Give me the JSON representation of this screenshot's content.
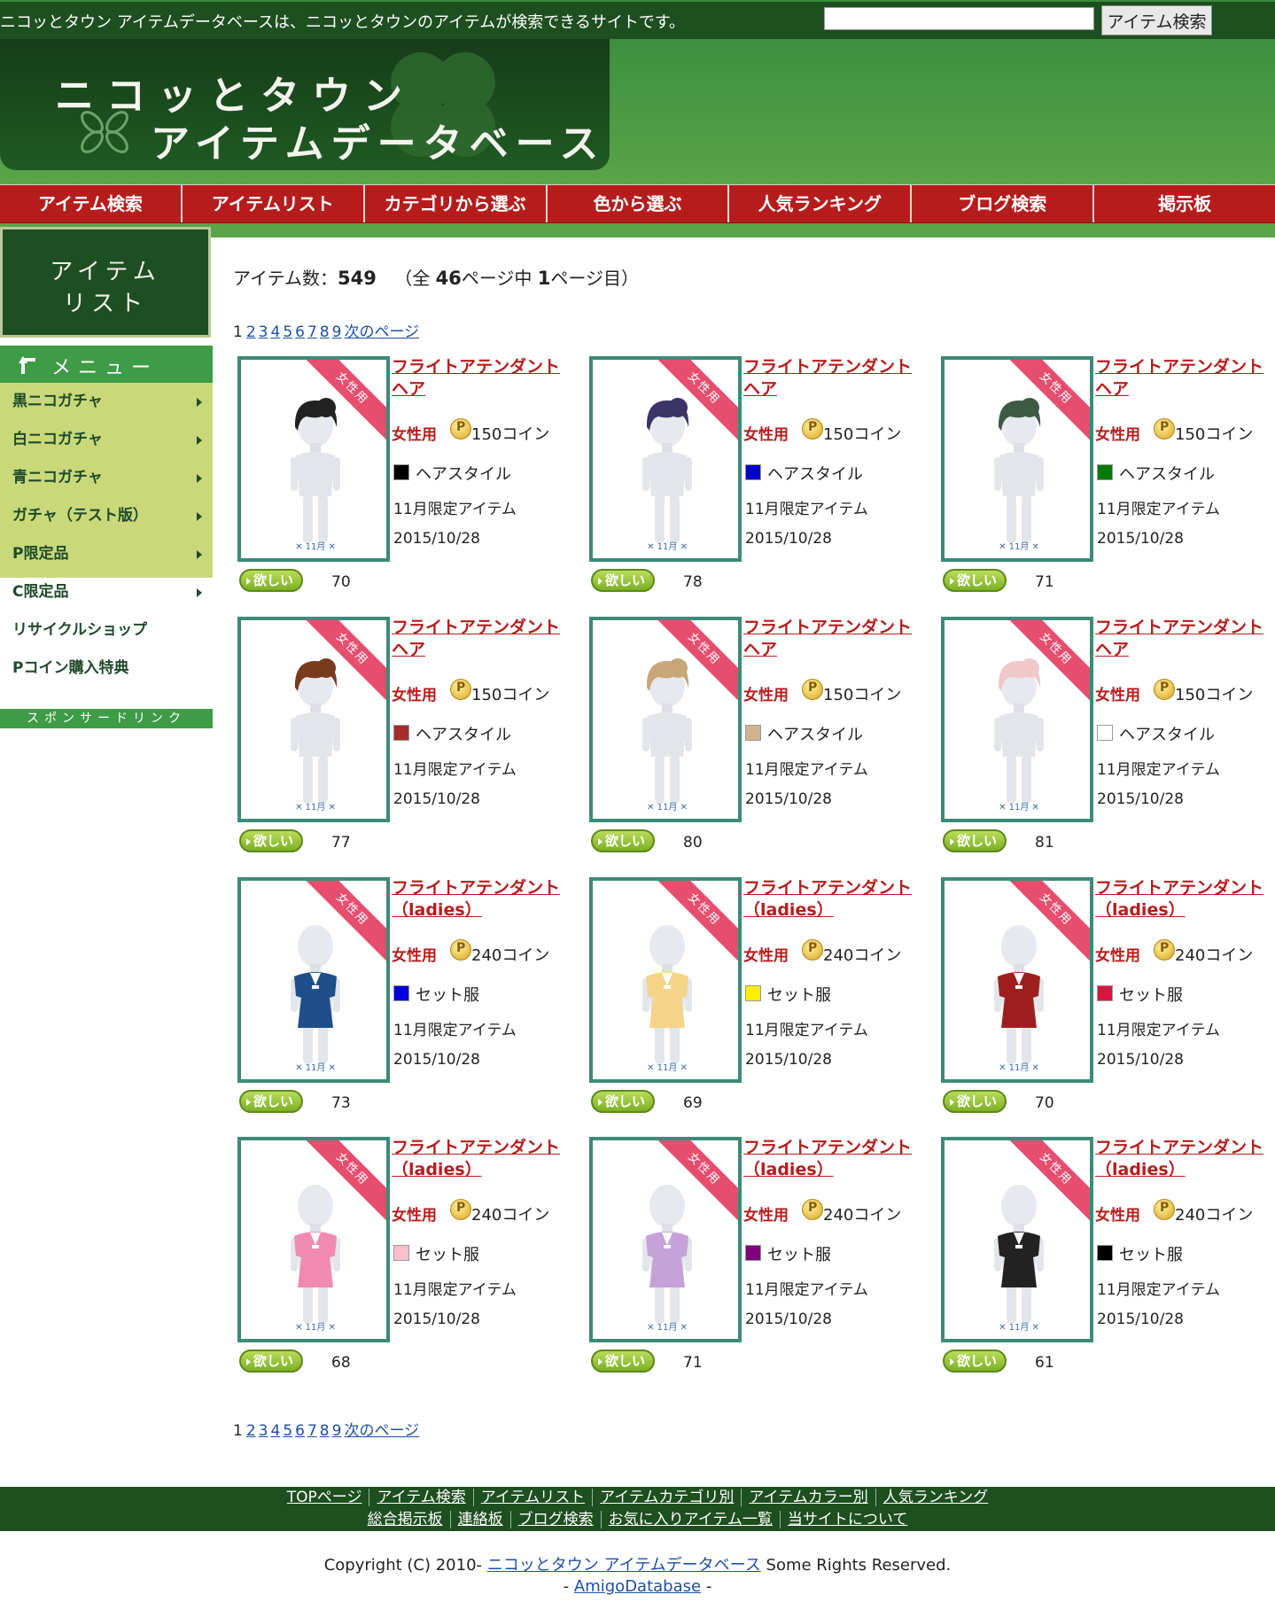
{
  "topbar": {
    "description": "ニコッとタウン アイテムデータベースは、ニコッとタウンのアイテムが検索できるサイトです。",
    "search_placeholder": "",
    "search_button": "アイテム検索"
  },
  "logo": {
    "line1": "ニコッとタウン",
    "line2": "アイテムデータベース"
  },
  "nav": [
    "アイテム検索",
    "アイテムリスト",
    "カテゴリから選ぶ",
    "色から選ぶ",
    "人気ランキング",
    "ブログ検索",
    "掲示板"
  ],
  "sidebar": {
    "title_line1": "アイテム",
    "title_line2": "リスト",
    "menu_label": "メニュー",
    "items": [
      {
        "label": "黒ニコガチャ",
        "arrow": true
      },
      {
        "label": "白ニコガチャ",
        "arrow": true
      },
      {
        "label": "青ニコガチャ",
        "arrow": true
      },
      {
        "label": "ガチャ（テスト版）",
        "arrow": true
      },
      {
        "label": "P限定品",
        "arrow": true
      },
      {
        "label": "C限定品",
        "arrow": true
      },
      {
        "label": "リサイクルショップ",
        "arrow": false
      },
      {
        "label": "Pコイン購入特典",
        "arrow": false
      }
    ],
    "sponsor": "スポンサードリンク"
  },
  "count": {
    "prefix": "アイテム数：",
    "total": "549",
    "mid1": "（全",
    "pages": "46",
    "mid2": "ページ中",
    "current": "1",
    "suffix": "ページ目）"
  },
  "pager": {
    "current": "1",
    "pages": [
      "2",
      "3",
      "4",
      "5",
      "6",
      "7",
      "8",
      "9"
    ],
    "next": "次のページ"
  },
  "item_common": {
    "ribbon": "女性用",
    "gender": "女性用",
    "limited": "11月限定アイテム",
    "date": "2015/10/28",
    "want": "欲しい"
  },
  "items": [
    {
      "name": "フライトアテンダントヘア",
      "price": "150コイン",
      "category": "ヘアスタイル",
      "color": "#000000",
      "kind": "hair",
      "tint": "#222222",
      "wants": "70"
    },
    {
      "name": "フライトアテンダントヘア",
      "price": "150コイン",
      "category": "ヘアスタイル",
      "color": "#0000cc",
      "kind": "hair",
      "tint": "#3a3468",
      "wants": "78"
    },
    {
      "name": "フライトアテンダントヘア",
      "price": "150コイン",
      "category": "ヘアスタイル",
      "color": "#007a00",
      "kind": "hair",
      "tint": "#3d5a44",
      "wants": "71"
    },
    {
      "name": "フライトアテンダントヘア",
      "price": "150コイン",
      "category": "ヘアスタイル",
      "color": "#a52a2a",
      "kind": "hair",
      "tint": "#7a3a1c",
      "wants": "77"
    },
    {
      "name": "フライトアテンダントヘア",
      "price": "150コイン",
      "category": "ヘアスタイル",
      "color": "#d2b48c",
      "kind": "hair",
      "tint": "#c9a57a",
      "wants": "80"
    },
    {
      "name": "フライトアテンダントヘア",
      "price": "150コイン",
      "category": "ヘアスタイル",
      "color": "#ffffff",
      "kind": "hair",
      "tint": "#f0c8c8",
      "wants": "81"
    },
    {
      "name": "フライトアテンダント（ladies）",
      "price": "240コイン",
      "category": "セット服",
      "color": "#0000dd",
      "kind": "dress",
      "tint": "#1f4f8a",
      "wants": "73"
    },
    {
      "name": "フライトアテンダント（ladies）",
      "price": "240コイン",
      "category": "セット服",
      "color": "#ffee00",
      "kind": "dress",
      "tint": "#f5d48a",
      "wants": "69"
    },
    {
      "name": "フライトアテンダント（ladies）",
      "price": "240コイン",
      "category": "セット服",
      "color": "#dc143c",
      "kind": "dress",
      "tint": "#9e1f1f",
      "wants": "70"
    },
    {
      "name": "フライトアテンダント（ladies）",
      "price": "240コイン",
      "category": "セット服",
      "color": "#ffc0cb",
      "kind": "dress",
      "tint": "#f08ab0",
      "wants": "68"
    },
    {
      "name": "フライトアテンダント（ladies）",
      "price": "240コイン",
      "category": "セット服",
      "color": "#800080",
      "kind": "dress",
      "tint": "#c6a2d8",
      "wants": "71"
    },
    {
      "name": "フライトアテンダント（ladies）",
      "price": "240コイン",
      "category": "セット服",
      "color": "#000000",
      "kind": "dress",
      "tint": "#222222",
      "wants": "61"
    }
  ],
  "footer": {
    "row1": [
      "TOPページ",
      "アイテム検索",
      "アイテムリスト",
      "アイテムカテゴリ別",
      "アイテムカラー別",
      "人気ランキング"
    ],
    "row2": [
      "総合掲示板",
      "連絡板",
      "ブログ検索",
      "お気に入りアイテム一覧",
      "当サイトについて"
    ]
  },
  "copyright": {
    "prefix": "Copyright (C) 2010-",
    "site": "ニコッとタウン アイテムデータベース",
    "suffix": "Some Rights Reserved.",
    "dash1": "-",
    "amigo": "AmigoDatabase",
    "dash2": "-"
  }
}
